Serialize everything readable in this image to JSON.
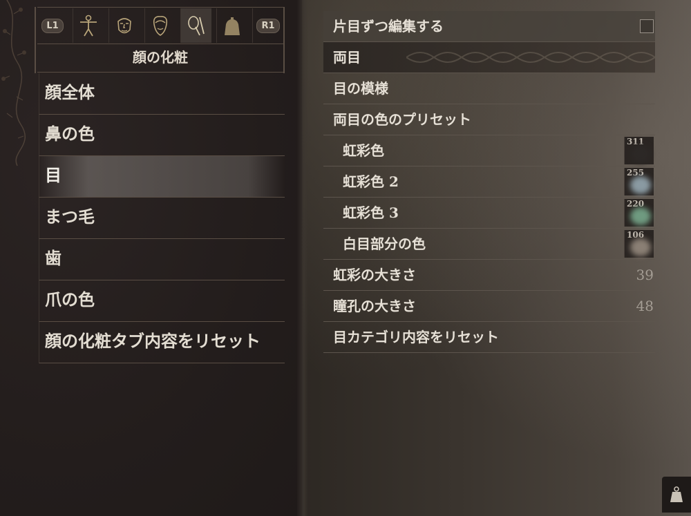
{
  "tabs": {
    "left_shoulder": "L1",
    "right_shoulder": "R1",
    "items": [
      {
        "icon": "body-icon"
      },
      {
        "icon": "face-icon"
      },
      {
        "icon": "hair-icon"
      },
      {
        "icon": "cosmetics-icon"
      },
      {
        "icon": "torso-icon"
      }
    ],
    "active_index": 3,
    "title": "顔の化粧"
  },
  "menu": {
    "items": [
      {
        "label": "顔全体"
      },
      {
        "label": "鼻の色"
      },
      {
        "label": "目"
      },
      {
        "label": "まつ毛"
      },
      {
        "label": "歯"
      },
      {
        "label": "爪の色"
      },
      {
        "label": "顔の化粧タブ内容をリセット"
      }
    ],
    "selected_index": 2
  },
  "right": {
    "edit_each_eye": "片目ずつ編集する",
    "both_eyes": "両目",
    "eye_pattern": "目の模様",
    "eye_color_preset": "両目の色のプリセット",
    "iris_color": {
      "label": "虹彩色",
      "value": "311",
      "color": "#2c2826"
    },
    "iris_color_2": {
      "label": "虹彩色 2",
      "value": "255",
      "color": "#8a9aa2"
    },
    "iris_color_3": {
      "label": "虹彩色 3",
      "value": "220",
      "color": "#6f9a80"
    },
    "sclera_color": {
      "label": "白目部分の色",
      "value": "106",
      "color": "#8a7f74"
    },
    "iris_size": {
      "label": "虹彩の大きさ",
      "value": "39"
    },
    "pupil_size": {
      "label": "瞳孔の大きさ",
      "value": "48"
    },
    "reset_eye": "目カテゴリ内容をリセット"
  },
  "corner_icon": "weight-icon"
}
